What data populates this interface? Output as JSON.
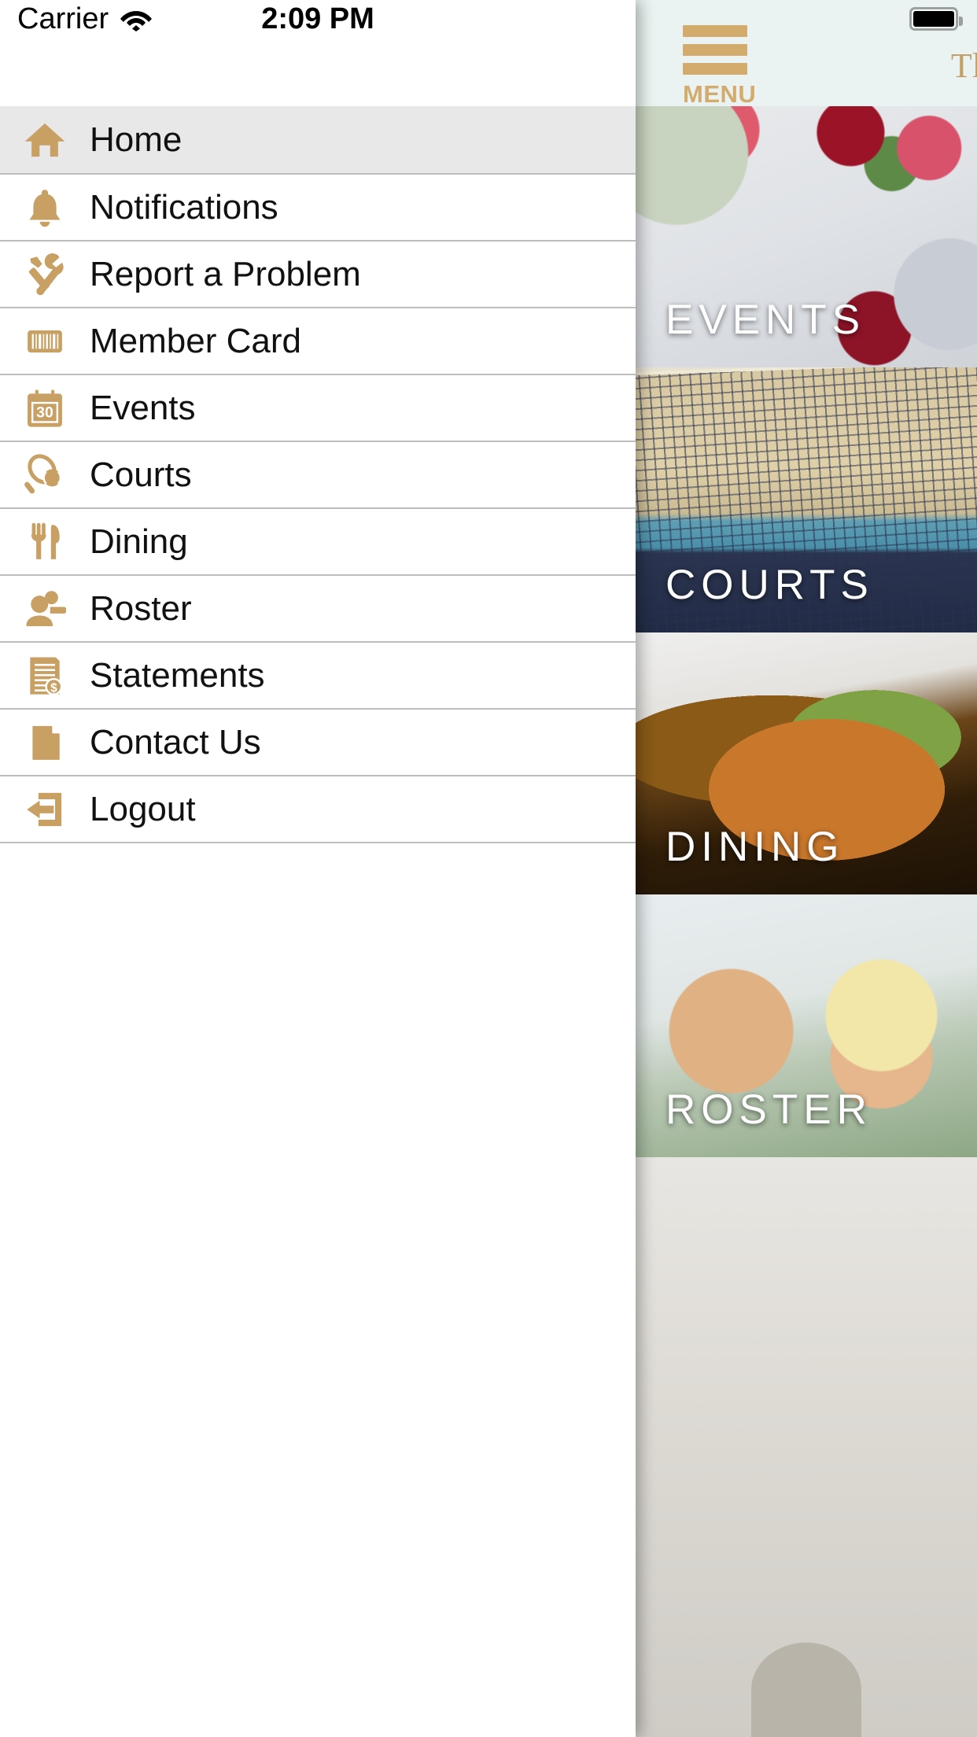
{
  "status_bar": {
    "carrier": "Carrier",
    "wifi_icon": "wifi-icon",
    "time": "2:09 PM",
    "battery_icon": "battery-full-icon"
  },
  "content_header": {
    "menu_button_label": "MENU",
    "hamburger_icon": "hamburger-menu-icon",
    "club_title": "Tl",
    "background_color": "#eaf3f1",
    "accent_color": "#d3ab6d"
  },
  "drawer": {
    "accent_color": "#c9a063",
    "active_row_color": "#e8e8e8",
    "items": [
      {
        "label": "Home",
        "icon": "home-icon",
        "active": true
      },
      {
        "label": "Notifications",
        "icon": "bell-icon",
        "active": false
      },
      {
        "label": "Report a Problem",
        "icon": "tools-icon",
        "active": false
      },
      {
        "label": "Member Card",
        "icon": "barcode-icon",
        "active": false
      },
      {
        "label": "Events",
        "icon": "calendar-icon",
        "active": false,
        "badge": "30"
      },
      {
        "label": "Courts",
        "icon": "tennis-racket-icon",
        "active": false
      },
      {
        "label": "Dining",
        "icon": "fork-knife-icon",
        "active": false
      },
      {
        "label": "Roster",
        "icon": "people-icon",
        "active": false
      },
      {
        "label": "Statements",
        "icon": "invoice-dollar-icon",
        "active": false
      },
      {
        "label": "Contact Us",
        "icon": "document-icon",
        "active": false
      },
      {
        "label": "Logout",
        "icon": "logout-arrow-icon",
        "active": false
      }
    ]
  },
  "main": {
    "tiles": [
      {
        "label": "EVENTS"
      },
      {
        "label": "COURTS"
      },
      {
        "label": "DINING"
      },
      {
        "label": "ROSTER"
      }
    ]
  }
}
